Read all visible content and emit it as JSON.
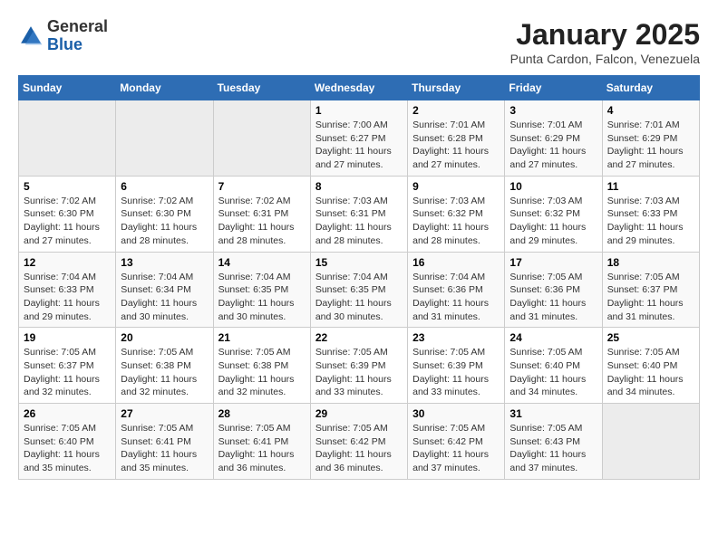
{
  "header": {
    "logo": {
      "general": "General",
      "blue": "Blue"
    },
    "title": "January 2025",
    "location": "Punta Cardon, Falcon, Venezuela"
  },
  "days_of_week": [
    "Sunday",
    "Monday",
    "Tuesday",
    "Wednesday",
    "Thursday",
    "Friday",
    "Saturday"
  ],
  "weeks": [
    [
      {
        "day": "",
        "sunrise": "",
        "sunset": "",
        "daylight": ""
      },
      {
        "day": "",
        "sunrise": "",
        "sunset": "",
        "daylight": ""
      },
      {
        "day": "",
        "sunrise": "",
        "sunset": "",
        "daylight": ""
      },
      {
        "day": "1",
        "sunrise": "Sunrise: 7:00 AM",
        "sunset": "Sunset: 6:27 PM",
        "daylight": "Daylight: 11 hours and 27 minutes."
      },
      {
        "day": "2",
        "sunrise": "Sunrise: 7:01 AM",
        "sunset": "Sunset: 6:28 PM",
        "daylight": "Daylight: 11 hours and 27 minutes."
      },
      {
        "day": "3",
        "sunrise": "Sunrise: 7:01 AM",
        "sunset": "Sunset: 6:29 PM",
        "daylight": "Daylight: 11 hours and 27 minutes."
      },
      {
        "day": "4",
        "sunrise": "Sunrise: 7:01 AM",
        "sunset": "Sunset: 6:29 PM",
        "daylight": "Daylight: 11 hours and 27 minutes."
      }
    ],
    [
      {
        "day": "5",
        "sunrise": "Sunrise: 7:02 AM",
        "sunset": "Sunset: 6:30 PM",
        "daylight": "Daylight: 11 hours and 27 minutes."
      },
      {
        "day": "6",
        "sunrise": "Sunrise: 7:02 AM",
        "sunset": "Sunset: 6:30 PM",
        "daylight": "Daylight: 11 hours and 28 minutes."
      },
      {
        "day": "7",
        "sunrise": "Sunrise: 7:02 AM",
        "sunset": "Sunset: 6:31 PM",
        "daylight": "Daylight: 11 hours and 28 minutes."
      },
      {
        "day": "8",
        "sunrise": "Sunrise: 7:03 AM",
        "sunset": "Sunset: 6:31 PM",
        "daylight": "Daylight: 11 hours and 28 minutes."
      },
      {
        "day": "9",
        "sunrise": "Sunrise: 7:03 AM",
        "sunset": "Sunset: 6:32 PM",
        "daylight": "Daylight: 11 hours and 28 minutes."
      },
      {
        "day": "10",
        "sunrise": "Sunrise: 7:03 AM",
        "sunset": "Sunset: 6:32 PM",
        "daylight": "Daylight: 11 hours and 29 minutes."
      },
      {
        "day": "11",
        "sunrise": "Sunrise: 7:03 AM",
        "sunset": "Sunset: 6:33 PM",
        "daylight": "Daylight: 11 hours and 29 minutes."
      }
    ],
    [
      {
        "day": "12",
        "sunrise": "Sunrise: 7:04 AM",
        "sunset": "Sunset: 6:33 PM",
        "daylight": "Daylight: 11 hours and 29 minutes."
      },
      {
        "day": "13",
        "sunrise": "Sunrise: 7:04 AM",
        "sunset": "Sunset: 6:34 PM",
        "daylight": "Daylight: 11 hours and 30 minutes."
      },
      {
        "day": "14",
        "sunrise": "Sunrise: 7:04 AM",
        "sunset": "Sunset: 6:35 PM",
        "daylight": "Daylight: 11 hours and 30 minutes."
      },
      {
        "day": "15",
        "sunrise": "Sunrise: 7:04 AM",
        "sunset": "Sunset: 6:35 PM",
        "daylight": "Daylight: 11 hours and 30 minutes."
      },
      {
        "day": "16",
        "sunrise": "Sunrise: 7:04 AM",
        "sunset": "Sunset: 6:36 PM",
        "daylight": "Daylight: 11 hours and 31 minutes."
      },
      {
        "day": "17",
        "sunrise": "Sunrise: 7:05 AM",
        "sunset": "Sunset: 6:36 PM",
        "daylight": "Daylight: 11 hours and 31 minutes."
      },
      {
        "day": "18",
        "sunrise": "Sunrise: 7:05 AM",
        "sunset": "Sunset: 6:37 PM",
        "daylight": "Daylight: 11 hours and 31 minutes."
      }
    ],
    [
      {
        "day": "19",
        "sunrise": "Sunrise: 7:05 AM",
        "sunset": "Sunset: 6:37 PM",
        "daylight": "Daylight: 11 hours and 32 minutes."
      },
      {
        "day": "20",
        "sunrise": "Sunrise: 7:05 AM",
        "sunset": "Sunset: 6:38 PM",
        "daylight": "Daylight: 11 hours and 32 minutes."
      },
      {
        "day": "21",
        "sunrise": "Sunrise: 7:05 AM",
        "sunset": "Sunset: 6:38 PM",
        "daylight": "Daylight: 11 hours and 32 minutes."
      },
      {
        "day": "22",
        "sunrise": "Sunrise: 7:05 AM",
        "sunset": "Sunset: 6:39 PM",
        "daylight": "Daylight: 11 hours and 33 minutes."
      },
      {
        "day": "23",
        "sunrise": "Sunrise: 7:05 AM",
        "sunset": "Sunset: 6:39 PM",
        "daylight": "Daylight: 11 hours and 33 minutes."
      },
      {
        "day": "24",
        "sunrise": "Sunrise: 7:05 AM",
        "sunset": "Sunset: 6:40 PM",
        "daylight": "Daylight: 11 hours and 34 minutes."
      },
      {
        "day": "25",
        "sunrise": "Sunrise: 7:05 AM",
        "sunset": "Sunset: 6:40 PM",
        "daylight": "Daylight: 11 hours and 34 minutes."
      }
    ],
    [
      {
        "day": "26",
        "sunrise": "Sunrise: 7:05 AM",
        "sunset": "Sunset: 6:40 PM",
        "daylight": "Daylight: 11 hours and 35 minutes."
      },
      {
        "day": "27",
        "sunrise": "Sunrise: 7:05 AM",
        "sunset": "Sunset: 6:41 PM",
        "daylight": "Daylight: 11 hours and 35 minutes."
      },
      {
        "day": "28",
        "sunrise": "Sunrise: 7:05 AM",
        "sunset": "Sunset: 6:41 PM",
        "daylight": "Daylight: 11 hours and 36 minutes."
      },
      {
        "day": "29",
        "sunrise": "Sunrise: 7:05 AM",
        "sunset": "Sunset: 6:42 PM",
        "daylight": "Daylight: 11 hours and 36 minutes."
      },
      {
        "day": "30",
        "sunrise": "Sunrise: 7:05 AM",
        "sunset": "Sunset: 6:42 PM",
        "daylight": "Daylight: 11 hours and 37 minutes."
      },
      {
        "day": "31",
        "sunrise": "Sunrise: 7:05 AM",
        "sunset": "Sunset: 6:43 PM",
        "daylight": "Daylight: 11 hours and 37 minutes."
      },
      {
        "day": "",
        "sunrise": "",
        "sunset": "",
        "daylight": ""
      }
    ]
  ]
}
